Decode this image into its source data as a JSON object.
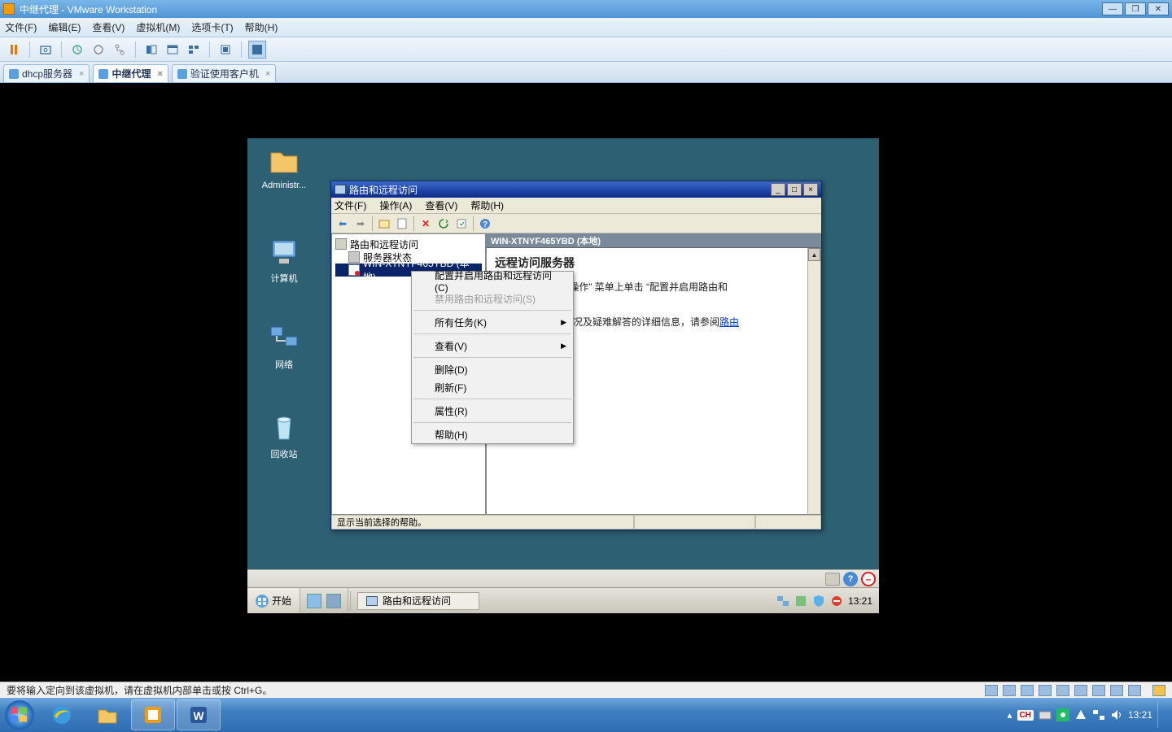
{
  "host": {
    "title": "中继代理 - VMware Workstation",
    "menu": {
      "file": "文件(F)",
      "edit": "编辑(E)",
      "view": "查看(V)",
      "vm": "虚拟机(M)",
      "tabs": "选项卡(T)",
      "help": "帮助(H)"
    },
    "tabs": [
      {
        "label": "dhcp服务器",
        "active": false
      },
      {
        "label": "中继代理",
        "active": true
      },
      {
        "label": "验证使用客户机",
        "active": false
      }
    ],
    "status": "要将输入定向到该虚拟机，请在虚拟机内部单击或按 Ctrl+G。"
  },
  "guest": {
    "icons": {
      "admin": "Administr...",
      "computer": "计算机",
      "network": "网络",
      "recycle": "回收站"
    },
    "rras": {
      "title": "路由和远程访问",
      "menu": {
        "file": "文件(F)",
        "action": "操作(A)",
        "view": "查看(V)",
        "help": "帮助(H)"
      },
      "tree": {
        "root": "路由和远程访问",
        "status": "服务器状态",
        "server": "WIN-XTNYF465YBD (本地)"
      },
      "rightHeader": "WIN-XTNYF465YBD (本地)",
      "body": {
        "heading": "远程访问服务器",
        "line1a": "远程访问，请在 “操作” 菜单上单击 “配置并启用路由和",
        "line2a": "远程访问、部署情况及疑难解答的详细信息，请参阅",
        "link": "路由"
      },
      "status": "显示当前选择的帮助。"
    },
    "context": {
      "configure": "配置并启用路由和远程访问(C)",
      "disable": "禁用路由和远程访问(S)",
      "alltasks": "所有任务(K)",
      "view": "查看(V)",
      "delete": "删除(D)",
      "refresh": "刷新(F)",
      "properties": "属性(R)",
      "help": "帮助(H)"
    },
    "taskbar": {
      "start": "开始",
      "task": "路由和远程访问",
      "clock": "13:21"
    }
  },
  "win7tray": {
    "clock": "13:21"
  }
}
